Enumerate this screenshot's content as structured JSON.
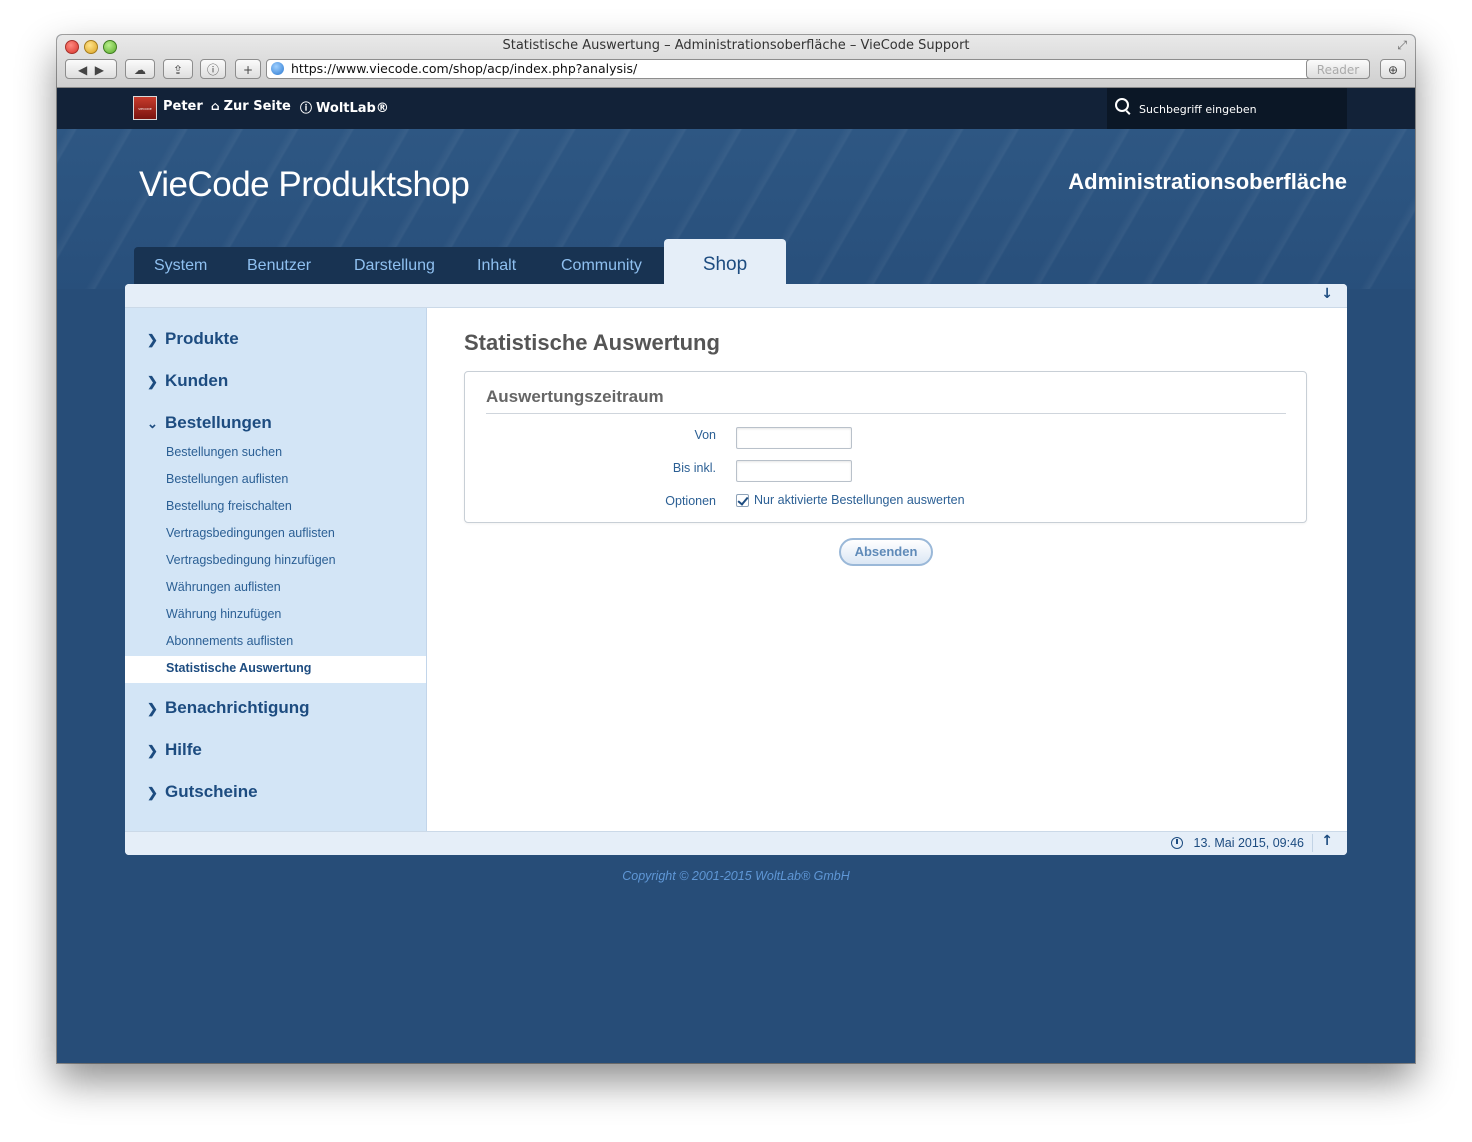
{
  "browser": {
    "window_title": "Statistische Auswertung – Administrationsoberfläche – VieCode Support",
    "url": "https://www.viecode.com/shop/acp/index.php?analysis/",
    "reader_label": "Reader",
    "new_tab_label": "+"
  },
  "topbar": {
    "user_name": "Peter",
    "avatar_text": "VIECODE",
    "links": [
      {
        "label": "Zur Seite",
        "icon": "home-icon"
      },
      {
        "label": "WoltLab®",
        "icon": "info-icon"
      }
    ],
    "search_placeholder": "Suchbegriff eingeben"
  },
  "header": {
    "site_title": "VieCode Produktshop",
    "admin_title": "Administrationsoberfläche"
  },
  "tabs": [
    {
      "label": "System"
    },
    {
      "label": "Benutzer"
    },
    {
      "label": "Darstellung"
    },
    {
      "label": "Inhalt"
    },
    {
      "label": "Community"
    }
  ],
  "active_tab": "Shop",
  "sidebar": {
    "sections": [
      {
        "label": "Produkte",
        "expanded": false
      },
      {
        "label": "Kunden",
        "expanded": false
      },
      {
        "label": "Bestellungen",
        "expanded": true
      },
      {
        "label": "Benachrichtigung",
        "expanded": false
      },
      {
        "label": "Hilfe",
        "expanded": false
      },
      {
        "label": "Gutscheine",
        "expanded": false
      }
    ],
    "bestellungen_items": [
      "Bestellungen suchen",
      "Bestellungen auflisten",
      "Bestellung freischalten",
      "Vertragsbedingungen auflisten",
      "Vertragsbedingung hinzufügen",
      "Währungen auflisten",
      "Währung hinzufügen",
      "Abonnements auflisten"
    ],
    "active_item": "Statistische Auswertung"
  },
  "main": {
    "page_title": "Statistische Auswertung",
    "fieldset_legend": "Auswertungszeitraum",
    "from_label": "Von",
    "from_value": "",
    "to_label": "Bis inkl.",
    "to_value": "",
    "options_label": "Optionen",
    "option_checkbox_label": "Nur aktivierte Bestellungen auswerten",
    "option_checked": true,
    "submit_label": "Absenden"
  },
  "footer": {
    "timestamp": "13. Mai 2015, 09:46",
    "copyright": "Copyright © 2001-2015 WoltLab® GmbH"
  },
  "colors": {
    "page_bg": "#274d78",
    "topbar_bg": "#122238",
    "accent": "#1d4c80",
    "sidebar_bg": "#d3e5f6"
  }
}
